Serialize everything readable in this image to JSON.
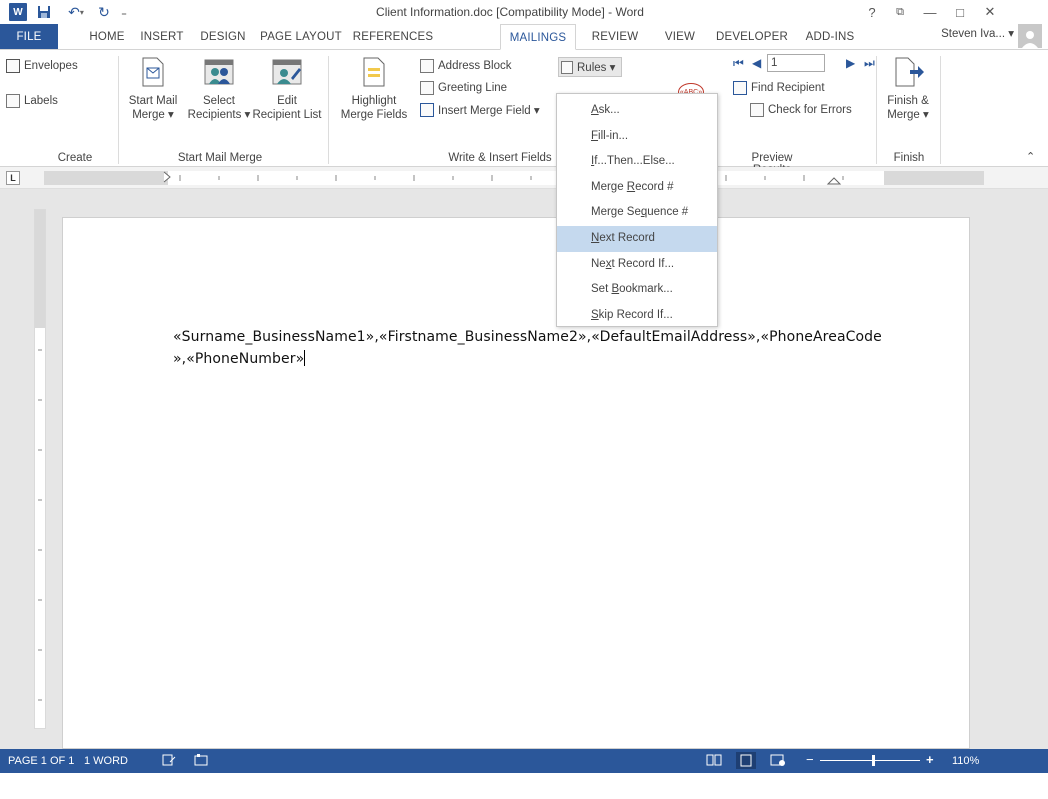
{
  "titlebar": {
    "title": "Client Information.doc [Compatibility Mode] - Word",
    "help": "?",
    "restore": "⧉",
    "minimize": "—",
    "maximize": "□",
    "close": "✕"
  },
  "tabs": {
    "file": "FILE",
    "home": "HOME",
    "insert": "INSERT",
    "design": "DESIGN",
    "page_layout": "PAGE LAYOUT",
    "references": "REFERENCES",
    "mailings": "MAILINGS",
    "review": "REVIEW",
    "view": "VIEW",
    "developer": "DEVELOPER",
    "addins": "ADD-INS",
    "user": "Steven Iva... ▾"
  },
  "ribbon": {
    "create": {
      "envelopes": "Envelopes",
      "labels": "Labels",
      "group": "Create"
    },
    "start_mail_merge": {
      "start_mail_merge_1": "Start Mail",
      "start_mail_merge_2": "Merge ▾",
      "select_recipients_1": "Select",
      "select_recipients_2": "Recipients ▾",
      "edit_recipient_list_1": "Edit",
      "edit_recipient_list_2": "Recipient List",
      "group": "Start Mail Merge"
    },
    "write_insert": {
      "highlight_1": "Highlight",
      "highlight_2": "Merge Fields",
      "address_block": "Address Block",
      "greeting_line": "Greeting Line",
      "insert_merge_field": "Insert Merge Field  ▾",
      "rules": "Rules ▾",
      "group": "Write & Insert Fields"
    },
    "preview": {
      "record_number": "1",
      "find_recipient": "Find Recipient",
      "check_errors": "Check for Errors",
      "group": "Preview Results"
    },
    "finish": {
      "finish_1": "Finish &",
      "finish_2": "Merge ▾",
      "group": "Finish"
    }
  },
  "rules_menu": {
    "items": [
      {
        "pre": "",
        "key": "A",
        "post": "sk..."
      },
      {
        "pre": "",
        "key": "F",
        "post": "ill-in..."
      },
      {
        "pre": "",
        "key": "I",
        "post": "f...Then...Else..."
      },
      {
        "pre": "Merge ",
        "key": "R",
        "post": "ecord #"
      },
      {
        "pre": "Merge Se",
        "key": "q",
        "post": "uence #"
      },
      {
        "pre": "",
        "key": "N",
        "post": "ext Record"
      },
      {
        "pre": "Ne",
        "key": "x",
        "post": "t Record If..."
      },
      {
        "pre": "Set ",
        "key": "B",
        "post": "ookmark..."
      },
      {
        "pre": "",
        "key": "S",
        "post": "kip Record If..."
      }
    ]
  },
  "document": {
    "line1": "«Surname_BusinessName1»,«Firstname_BusinessName2»,«DefaultEmailAddress»,«PhoneAreaCode",
    "line2": "»,«PhoneNumber»"
  },
  "statusbar": {
    "page": "PAGE 1 OF 1",
    "words": "1 WORD",
    "zoom_minus": "−",
    "zoom_plus": "+",
    "zoom": "110%"
  },
  "colors": {
    "accent": "#2b579a",
    "menu_hover": "#c5d9ee"
  }
}
